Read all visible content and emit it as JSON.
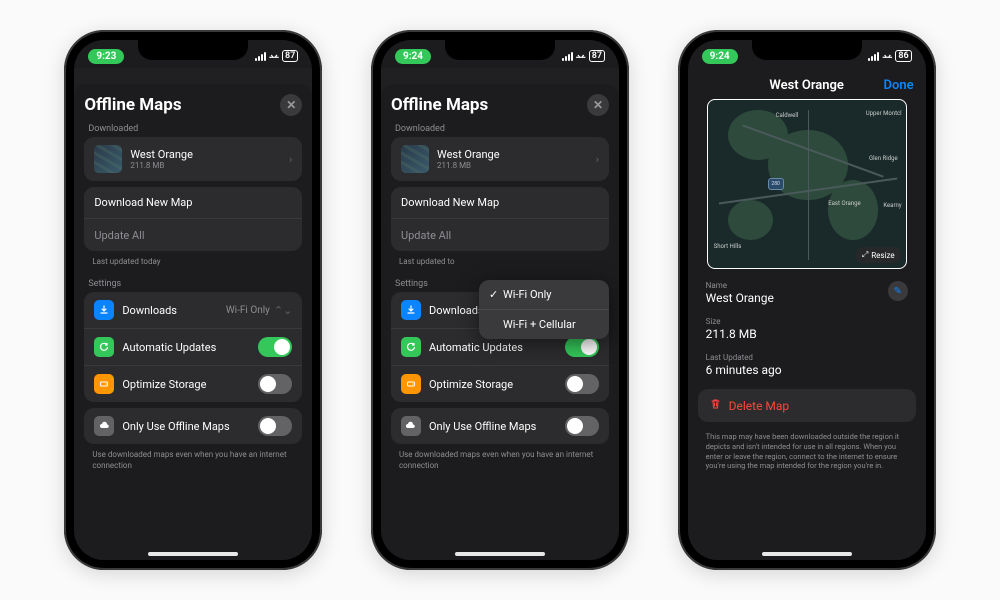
{
  "phones": [
    {
      "time": "9:23",
      "battery": "87",
      "title": "Offline Maps",
      "sections": {
        "downloaded_label": "Downloaded",
        "map_item": {
          "name": "West Orange",
          "size": "211.8 MB"
        },
        "download_new": "Download New Map",
        "update_all": "Update All",
        "last_updated": "Last updated today",
        "settings_label": "Settings",
        "downloads": {
          "label": "Downloads",
          "value": "Wi-Fi Only"
        },
        "auto_updates": "Automatic Updates",
        "optimize": "Optimize Storage",
        "only_offline": "Only Use Offline Maps",
        "footer": "Use downloaded maps even when you have an internet connection"
      }
    },
    {
      "time": "9:24",
      "battery": "87",
      "title": "Offline Maps",
      "sections": {
        "downloaded_label": "Downloaded",
        "map_item": {
          "name": "West Orange",
          "size": "211.8 MB"
        },
        "download_new": "Download New Map",
        "update_all": "Update All",
        "last_updated": "Last updated to",
        "settings_label": "Settings",
        "downloads": {
          "label": "Downloads"
        },
        "auto_updates": "Automatic Updates",
        "optimize": "Optimize Storage",
        "only_offline": "Only Use Offline Maps",
        "footer": "Use downloaded maps even when you have an internet connection"
      },
      "popover": {
        "opt1": "Wi-Fi Only",
        "opt2": "Wi-Fi + Cellular"
      }
    },
    {
      "time": "9:24",
      "battery": "86",
      "detail": {
        "title": "West Orange",
        "done": "Done",
        "resize": "Resize",
        "towns": [
          "Caldwell",
          "Upper Montcl",
          "Glen Ridge",
          "East Orange",
          "Kearny",
          "Short Hills"
        ],
        "name_label": "Name",
        "name_value": "West Orange",
        "size_label": "Size",
        "size_value": "211.8 MB",
        "updated_label": "Last Updated",
        "updated_value": "6 minutes ago",
        "delete": "Delete Map",
        "disclaimer": "This map may have been downloaded outside the region it depicts and isn't intended for use in all regions. When you enter or leave the region, connect to the internet to ensure you're using the map intended for the region you're in."
      }
    }
  ]
}
